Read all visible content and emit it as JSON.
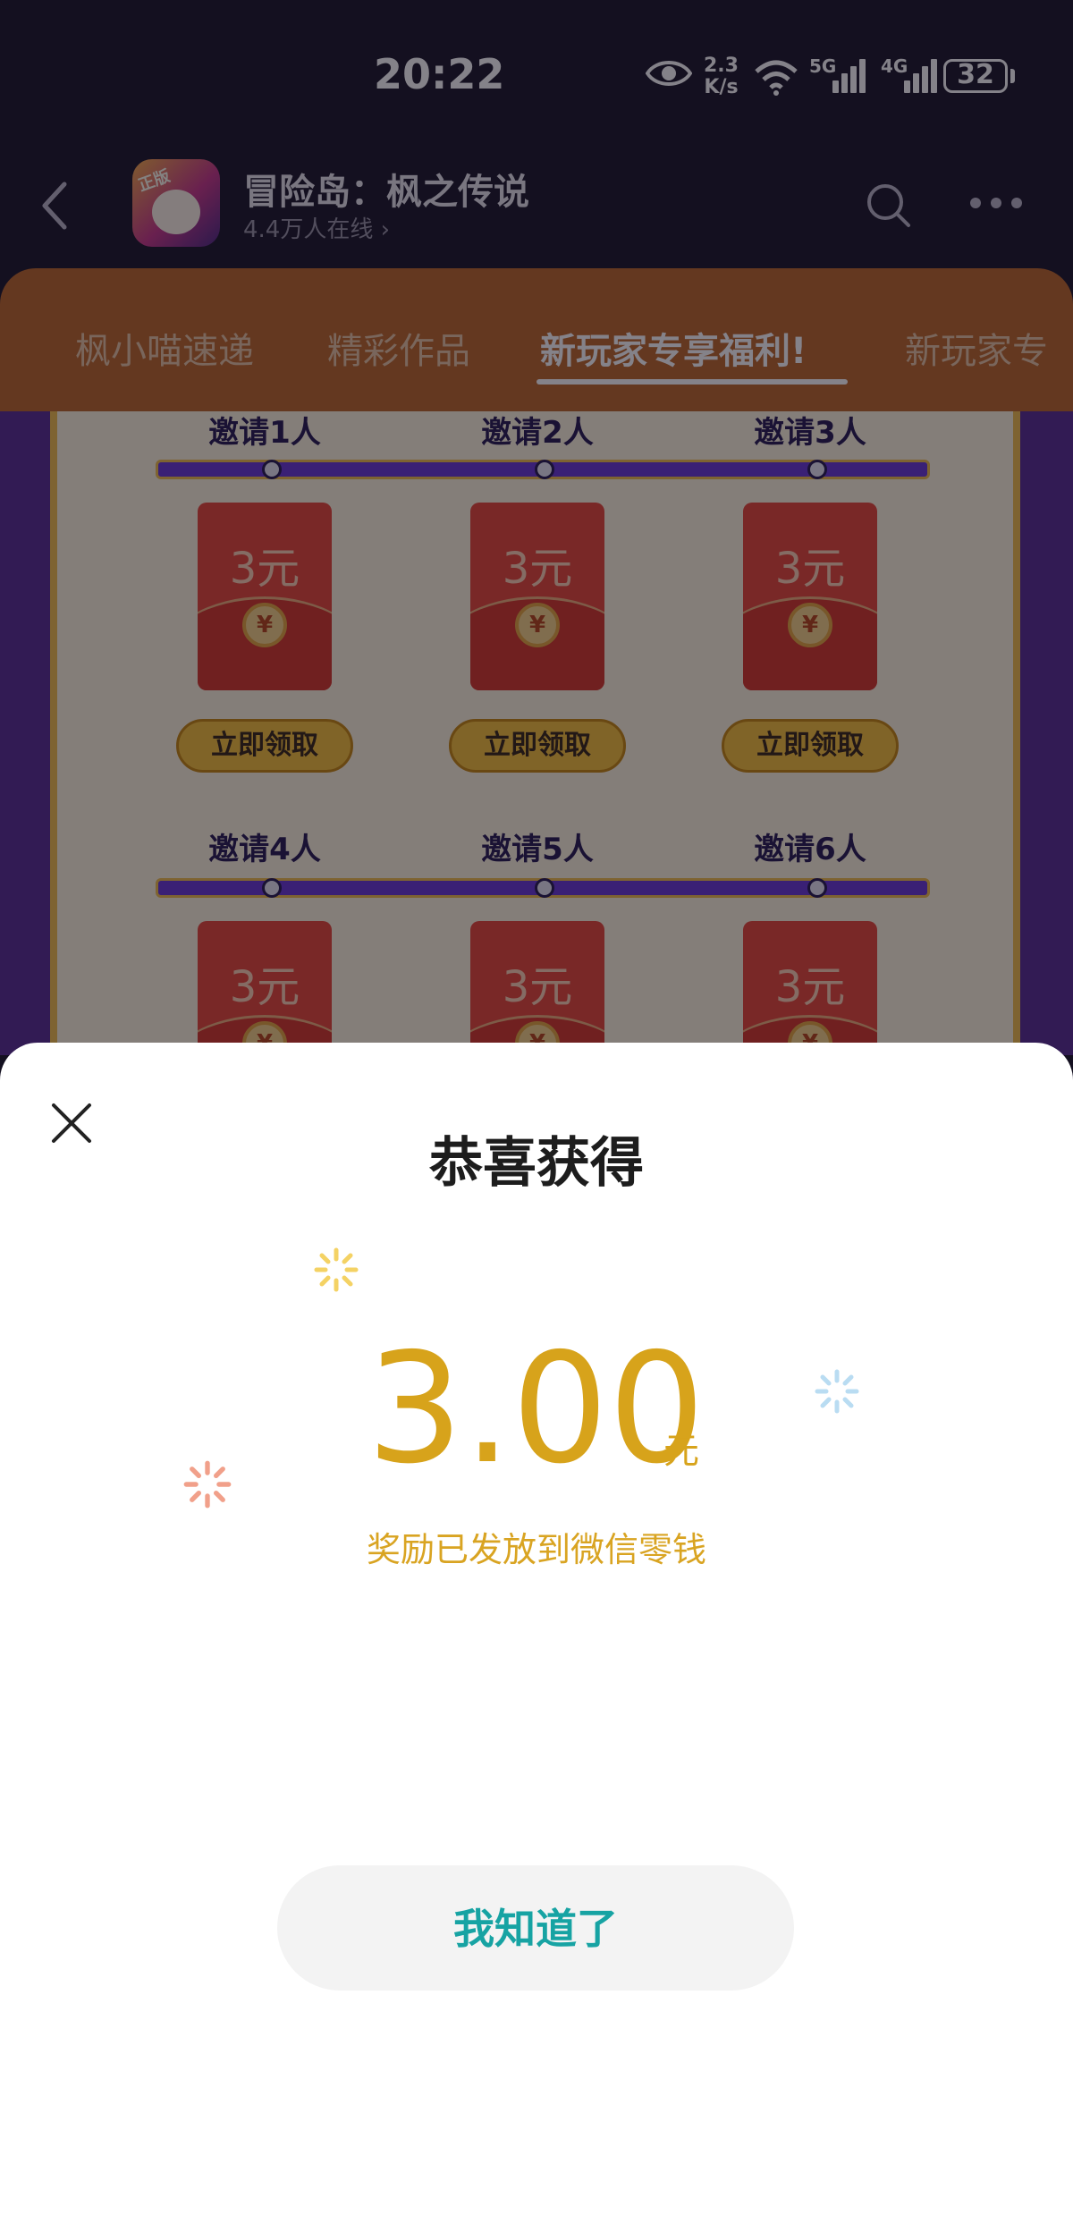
{
  "status_bar": {
    "time": "20:22",
    "speed_value": "2.3",
    "speed_unit": "K/s",
    "net1": "5G",
    "net2": "4G",
    "battery": "32"
  },
  "app_bar": {
    "title": "冒险岛：枫之传说",
    "online": "4.4万人在线 ›",
    "game_icon_tag": "正版"
  },
  "tabs": [
    {
      "label": "枫小喵速递"
    },
    {
      "label": "精彩作品"
    },
    {
      "label": "新玩家专享福利!"
    },
    {
      "label": "新玩家专"
    }
  ],
  "rewards": {
    "row1": [
      {
        "label": "邀请1人",
        "amount": "3元",
        "button": "立即领取"
      },
      {
        "label": "邀请2人",
        "amount": "3元",
        "button": "立即领取"
      },
      {
        "label": "邀请3人",
        "amount": "3元",
        "button": "立即领取"
      }
    ],
    "row2": [
      {
        "label": "邀请4人",
        "amount": "3元"
      },
      {
        "label": "邀请5人",
        "amount": "3元"
      },
      {
        "label": "邀请6人",
        "amount": "3元"
      }
    ],
    "coin_symbol": "¥"
  },
  "popup": {
    "title": "恭喜获得",
    "amount": "3.00",
    "unit": "元",
    "message": "奖励已发放到微信零钱",
    "button": "我知道了"
  },
  "colors": {
    "accent_gold": "#d7a31b",
    "button_text": "#17a3a3",
    "tab_bar": "#bf6a2c",
    "banner": "#5a3194"
  }
}
